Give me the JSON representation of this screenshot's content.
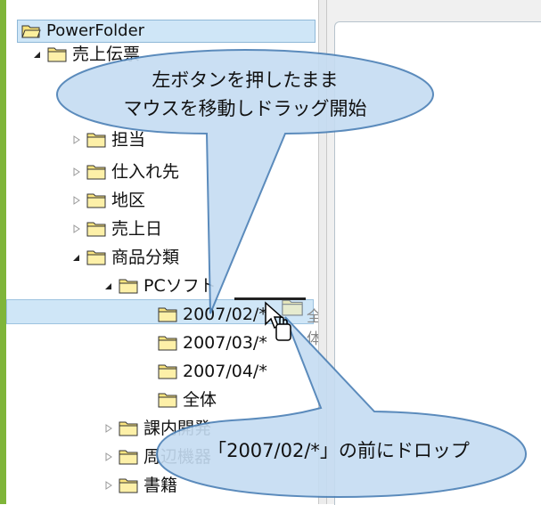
{
  "tree": {
    "root": "PowerFolder",
    "nodes": [
      {
        "label": "売上伝票",
        "state": "expanded"
      },
      {
        "label": "担当",
        "state": "collapsed"
      },
      {
        "label": "仕入れ先",
        "state": "collapsed"
      },
      {
        "label": "地区",
        "state": "collapsed"
      },
      {
        "label": "売上日",
        "state": "collapsed"
      },
      {
        "label": "商品分類",
        "state": "expanded"
      },
      {
        "label": "PCソフト",
        "state": "expanded"
      },
      {
        "label": "2007/02/*",
        "state": "leaf"
      },
      {
        "label": "2007/03/*",
        "state": "leaf"
      },
      {
        "label": "2007/04/*",
        "state": "leaf"
      },
      {
        "label": "全体",
        "state": "leaf"
      },
      {
        "label": "課内開発",
        "state": "collapsed"
      },
      {
        "label": "周辺機器",
        "state": "collapsed"
      },
      {
        "label": "書籍",
        "state": "collapsed"
      }
    ]
  },
  "drag": {
    "ghost_label": "全体"
  },
  "callouts": {
    "top_line1": "左ボタンを押したまま",
    "top_line2": "マウスを移動しドラッグ開始",
    "bottom": "「2007/02/*」の前にドロップ"
  },
  "colors": {
    "accent_green": "#7fb539",
    "callout_fill": "#c5dcf2",
    "callout_stroke": "#4a7fb5",
    "selection": "#cfe6f7"
  }
}
